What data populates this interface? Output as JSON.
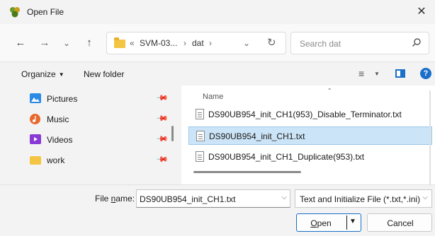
{
  "window": {
    "title": "Open File"
  },
  "nav": {
    "back_glyph": "←",
    "forward_glyph": "→",
    "recent_glyph": "⌄",
    "up_glyph": "↑",
    "refresh_glyph": "↻",
    "breadcrumb": [
      {
        "label": "SVM-03..."
      },
      {
        "label": "dat"
      }
    ],
    "separator": "›",
    "overflow": "«",
    "dropdown_glyph": "⌄"
  },
  "search": {
    "placeholder": "Search dat"
  },
  "toolbar": {
    "organize_label": "Organize",
    "new_folder_label": "New folder"
  },
  "sidebar": {
    "items": [
      {
        "label": "Pictures",
        "icon": "pictures-icon",
        "color": "#2a8ae6"
      },
      {
        "label": "Music",
        "icon": "music-icon",
        "color": "#e8692c"
      },
      {
        "label": "Videos",
        "icon": "videos-icon",
        "color": "#8a3ad6"
      },
      {
        "label": "work",
        "icon": "folder-icon",
        "color": "#f4c542"
      }
    ]
  },
  "files": {
    "column_name": "Name",
    "rows": [
      {
        "name": "DS90UB954_init_CH1(953)_Disable_Terminator.txt",
        "selected": false
      },
      {
        "name": "DS90UB954_init_CH1.txt",
        "selected": true
      },
      {
        "name": "DS90UB954_init_CH1_Duplicate(953).txt",
        "selected": false
      }
    ]
  },
  "footer": {
    "file_name_label_prefix": "File ",
    "file_name_label_accel": "n",
    "file_name_label_suffix": "ame:",
    "file_name_value": "DS90UB954_init_CH1.txt",
    "file_type_value": "Text and Initialize File (*.txt,*.ini)",
    "open_label_accel": "O",
    "open_label_rest": "pen",
    "cancel_label": "Cancel"
  },
  "colors": {
    "accent": "#1a6fc9",
    "selection": "#cce4f7"
  }
}
